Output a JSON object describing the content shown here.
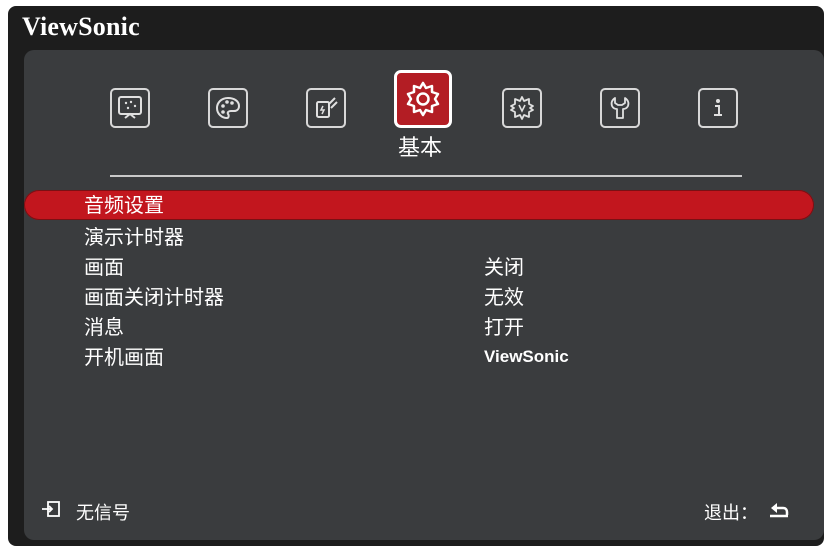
{
  "brand": "ViewSonic",
  "tabs": [
    {
      "name": "display",
      "icon": "display-icon",
      "active": false
    },
    {
      "name": "image",
      "icon": "palette-icon",
      "active": false
    },
    {
      "name": "power",
      "icon": "power-plug-icon",
      "active": false
    },
    {
      "name": "basic",
      "icon": "gear-icon",
      "active": true,
      "label": "基本"
    },
    {
      "name": "advanced",
      "icon": "advanced-gear-icon",
      "active": false
    },
    {
      "name": "system",
      "icon": "wrench-icon",
      "active": false
    },
    {
      "name": "information",
      "icon": "info-icon",
      "active": false
    }
  ],
  "active_tab_label": "基本",
  "menu": [
    {
      "label": "音频设置",
      "value": "",
      "selected": true
    },
    {
      "label": "演示计时器",
      "value": "",
      "selected": false
    },
    {
      "label": "画面",
      "value": "关闭",
      "selected": false
    },
    {
      "label": "画面关闭计时器",
      "value": "无效",
      "selected": false
    },
    {
      "label": "消息",
      "value": "打开",
      "selected": false
    },
    {
      "label": "开机画面",
      "value": "ViewSonic",
      "selected": false
    }
  ],
  "footer": {
    "input_status": "无信号",
    "input_icon": "input-source-icon",
    "exit_label": "退出：",
    "exit_icon": "return-arrow-icon"
  },
  "colors": {
    "accent": "#c2161e",
    "panel": "#3a3c3e",
    "frame": "#1d1d1d"
  }
}
